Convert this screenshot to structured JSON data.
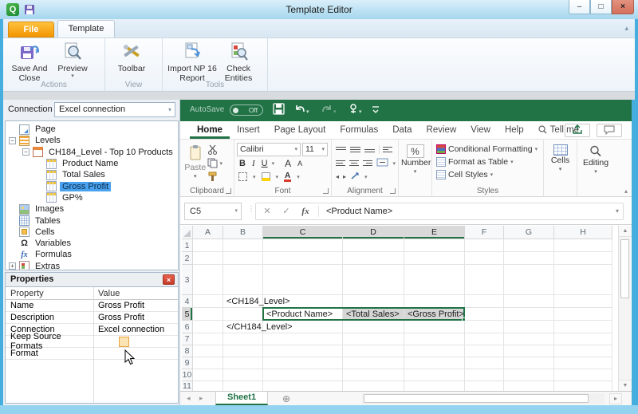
{
  "window": {
    "title": "Template Editor",
    "app_badge": "Q"
  },
  "icons": {
    "min": "–",
    "max": "□",
    "close": "×",
    "dd": "▾",
    "collapse_up": "▴",
    "left": "◂",
    "right": "▸",
    "up": "▲",
    "down": "▼",
    "plus": "+",
    "minus": "−",
    "new_sheet": "⊕",
    "dots": "⋮",
    "cancel": "✕",
    "enter": "✓",
    "fx": "fx",
    "omega": "Ω"
  },
  "np_ribbon": {
    "file_tab": "File",
    "template_tab": "Template",
    "save_and_close": "Save And Close",
    "preview": "Preview",
    "toolbar": "Toolbar",
    "import_np": "Import NP 16 Report",
    "check_entities": "Check Entities",
    "group_actions": "Actions",
    "group_view": "View",
    "group_tools": "Tools"
  },
  "connection": {
    "label": "Connection",
    "value": "Excel connection"
  },
  "tree": {
    "items": [
      {
        "label": "Page",
        "icon": "page",
        "level": 1
      },
      {
        "label": "Levels",
        "icon": "levels",
        "level": 1,
        "expander": "minus"
      },
      {
        "label": "CH184_Level - Top 10 Products",
        "icon": "levelnode",
        "level": 2,
        "expander": "minus"
      },
      {
        "label": "Product Name",
        "icon": "col",
        "level": 3
      },
      {
        "label": "Total Sales",
        "icon": "col",
        "level": 3
      },
      {
        "label": "Gross Profit",
        "icon": "col",
        "level": 3,
        "selected": true
      },
      {
        "label": "GP%",
        "icon": "col",
        "level": 3
      },
      {
        "label": "Images",
        "icon": "images",
        "level": 1
      },
      {
        "label": "Tables",
        "icon": "tables",
        "level": 1
      },
      {
        "label": "Cells",
        "icon": "cells",
        "level": 1
      },
      {
        "label": "Variables",
        "icon": "variables",
        "level": 1
      },
      {
        "label": "Formulas",
        "icon": "formulas",
        "level": 1
      },
      {
        "label": "Extras",
        "icon": "extras",
        "level": 1,
        "expander": "plus"
      }
    ]
  },
  "properties": {
    "title": "Properties",
    "col_property": "Property",
    "col_value": "Value",
    "rows": [
      {
        "property": "Name",
        "value": "Gross Profit",
        "type": "text"
      },
      {
        "property": "Description",
        "value": "Gross Profit",
        "type": "text"
      },
      {
        "property": "Connection",
        "value": "Excel connection",
        "type": "text"
      },
      {
        "property": "Keep Source Formats",
        "value": "",
        "type": "checkbox"
      },
      {
        "property": "Format",
        "value": "",
        "type": "text"
      }
    ]
  },
  "excel": {
    "autosave_label": "AutoSave",
    "autosave_state": "Off",
    "tabs": [
      {
        "label": "Home",
        "active": true
      },
      {
        "label": "Insert"
      },
      {
        "label": "Page Layout"
      },
      {
        "label": "Formulas"
      },
      {
        "label": "Data"
      },
      {
        "label": "Review"
      },
      {
        "label": "View"
      },
      {
        "label": "Help"
      }
    ],
    "tell_me": "Tell me",
    "ribbon": {
      "paste": "Paste",
      "font_name": "Calibri",
      "font_size": "11",
      "bold": "B",
      "italic": "I",
      "underline": "U",
      "grow": "A",
      "shrink": "A",
      "percent": "%",
      "number_label": "Number",
      "styles_buttons": [
        "Conditional Formatting",
        "Format as Table",
        "Cell Styles"
      ],
      "cells_label": "Cells",
      "editing_label": "Editing",
      "group_clipboard": "Clipboard",
      "group_font": "Font",
      "group_alignment": "Alignment",
      "group_styles": "Styles"
    },
    "formula_bar": {
      "name_box": "C5",
      "fx": "fx",
      "value": "<Product Name>"
    },
    "grid": {
      "columns": [
        "A",
        "B",
        "C",
        "D",
        "E",
        "F",
        "G",
        "H"
      ],
      "rows": [
        "1",
        "2",
        "3",
        "4",
        "5",
        "6",
        "7",
        "8",
        "9",
        "10",
        "11"
      ],
      "cells": {
        "B4": "<CH184_Level>",
        "C5": "<Product Name>",
        "D5": "<Total Sales>",
        "E5": "<Gross Profit>",
        "B6": "</CH184_Level>"
      },
      "active_cell": "C5",
      "selected_cells": [
        "D5",
        "E5"
      ],
      "selected_columns": [
        "C",
        "D",
        "E"
      ],
      "selected_rows": [
        "5"
      ]
    },
    "sheet_tab": "Sheet1"
  },
  "colors": {
    "excel_green": "#217346",
    "file_tab_orange": "#f29400",
    "tree_selection_blue": "#4aa2ee",
    "close_button_red": "#d4705c"
  }
}
